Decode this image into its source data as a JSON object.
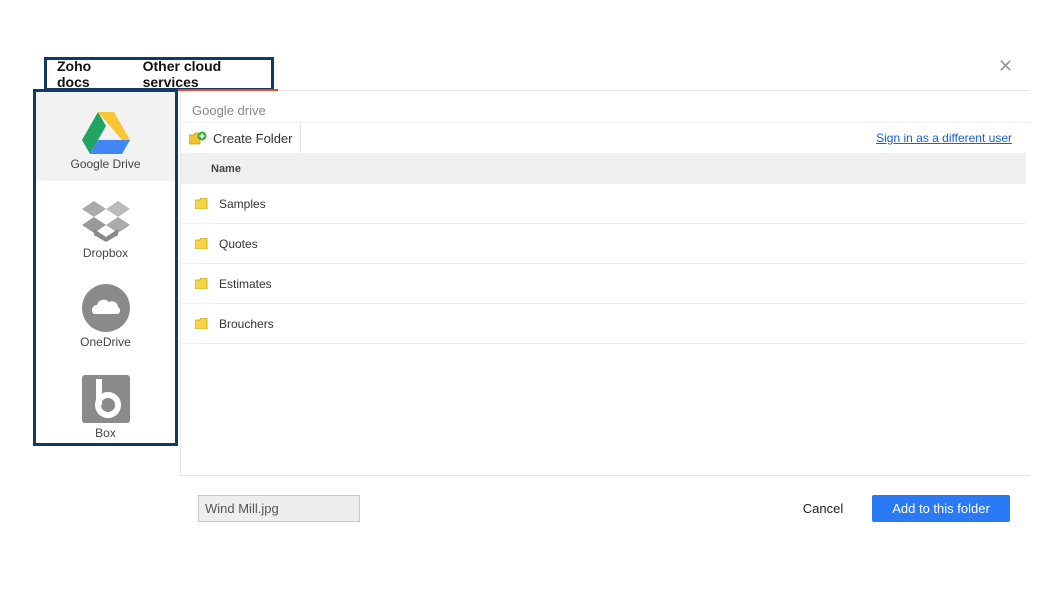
{
  "tabs": [
    {
      "label": "Zoho docs"
    },
    {
      "label": "Other cloud services"
    }
  ],
  "close_icon": "close-icon",
  "providers": [
    {
      "label": "Google Drive",
      "icon": "google-drive-icon"
    },
    {
      "label": "Dropbox",
      "icon": "dropbox-icon"
    },
    {
      "label": "OneDrive",
      "icon": "onedrive-icon"
    },
    {
      "label": "Box",
      "icon": "box-icon"
    }
  ],
  "breadcrumb": "Google drive",
  "toolbar": {
    "create_folder": "Create Folder",
    "sign_in": "Sign in as a different user"
  },
  "table": {
    "header": "Name",
    "rows": [
      {
        "name": "Samples"
      },
      {
        "name": "Quotes"
      },
      {
        "name": "Estimates"
      },
      {
        "name": "Brouchers"
      }
    ]
  },
  "footer": {
    "filename": "Wind Mill.jpg",
    "cancel": "Cancel",
    "add": "Add to this folder"
  },
  "colors": {
    "accent": "#2a7af5",
    "highlight_border": "#0d3b66",
    "active_tab_underline": "#e0483a"
  }
}
